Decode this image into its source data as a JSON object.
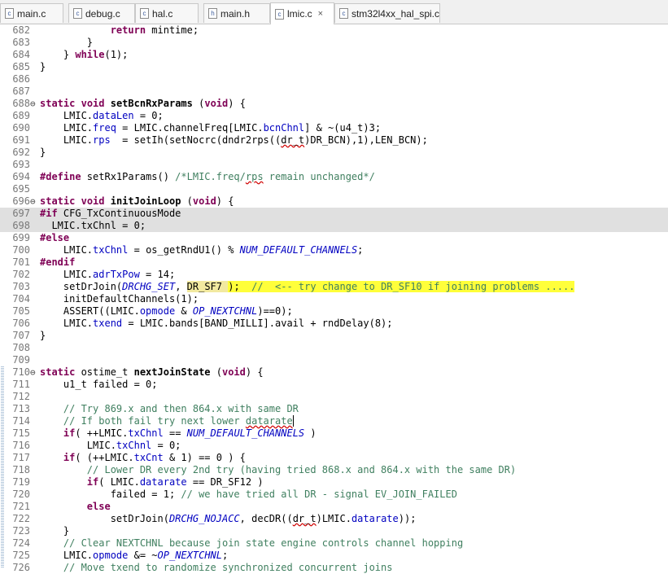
{
  "tabs": [
    {
      "label": "main.c",
      "icon": "c-file-icon",
      "active": false
    },
    {
      "label": "debug.c",
      "icon": "c-file-icon",
      "active": false
    },
    {
      "label": "hal.c",
      "icon": "c-file-icon",
      "active": false
    },
    {
      "label": "main.h",
      "icon": "h-file-icon",
      "active": false
    },
    {
      "label": "lmic.c",
      "icon": "c-file-icon",
      "active": true,
      "close": "×"
    },
    {
      "label": "stm32l4xx_hal_spi.c",
      "icon": "c-file-icon",
      "active": false
    }
  ],
  "colors": {
    "keyword": "#7f0055",
    "field": "#0000c0",
    "comment": "#3f7f5f",
    "highlight": "#ffff3a",
    "line_number": "#787878"
  },
  "lines": [
    {
      "n": "682",
      "seg": [
        {
          "t": "            "
        },
        {
          "t": "return",
          "c": "kw"
        },
        {
          "t": " mintime;"
        }
      ]
    },
    {
      "n": "683",
      "seg": [
        {
          "t": "        }"
        }
      ]
    },
    {
      "n": "684",
      "seg": [
        {
          "t": "    } "
        },
        {
          "t": "while",
          "c": "kw"
        },
        {
          "t": "(1);"
        }
      ]
    },
    {
      "n": "685",
      "seg": [
        {
          "t": "}"
        }
      ]
    },
    {
      "n": "686",
      "seg": []
    },
    {
      "n": "687",
      "seg": []
    },
    {
      "n": "688",
      "fold": "⊖",
      "seg": [
        {
          "t": "static",
          "c": "kw"
        },
        {
          "t": " "
        },
        {
          "t": "void",
          "c": "kw"
        },
        {
          "t": " "
        },
        {
          "t": "setBcnRxParams",
          "c": "b"
        },
        {
          "t": " ("
        },
        {
          "t": "void",
          "c": "kw"
        },
        {
          "t": ") {"
        }
      ]
    },
    {
      "n": "689",
      "seg": [
        {
          "t": "    LMIC."
        },
        {
          "t": "dataLen",
          "c": "fld"
        },
        {
          "t": " = 0;"
        }
      ]
    },
    {
      "n": "690",
      "seg": [
        {
          "t": "    LMIC."
        },
        {
          "t": "freq",
          "c": "fld"
        },
        {
          "t": " = LMIC.channelFreq[LMIC."
        },
        {
          "t": "bcnChnl",
          "c": "fld"
        },
        {
          "t": "] & ~(u4_t)3;"
        }
      ]
    },
    {
      "n": "691",
      "seg": [
        {
          "t": "    LMIC."
        },
        {
          "t": "rps",
          "c": "fld"
        },
        {
          "t": "  = setIh(setNocrc(dndr2rps(("
        },
        {
          "t": "dr_t",
          "c": "u"
        },
        {
          "t": ")DR_BCN),1),LEN_BCN);"
        }
      ]
    },
    {
      "n": "692",
      "seg": [
        {
          "t": "}"
        }
      ]
    },
    {
      "n": "693",
      "seg": []
    },
    {
      "n": "694",
      "seg": [
        {
          "t": "#define",
          "c": "kw"
        },
        {
          "t": " setRx1Params() "
        },
        {
          "t": "/*LMIC.freq/",
          "c": "cm"
        },
        {
          "t": "rps",
          "c": "cm u"
        },
        {
          "t": " remain unchanged*/",
          "c": "cm"
        }
      ]
    },
    {
      "n": "695",
      "seg": []
    },
    {
      "n": "696",
      "fold": "⊖",
      "seg": [
        {
          "t": "static",
          "c": "kw"
        },
        {
          "t": " "
        },
        {
          "t": "void",
          "c": "kw"
        },
        {
          "t": " "
        },
        {
          "t": "initJoinLoop",
          "c": "b"
        },
        {
          "t": " ("
        },
        {
          "t": "void",
          "c": "kw"
        },
        {
          "t": ") {"
        }
      ]
    },
    {
      "n": "697",
      "hl": true,
      "seg": [
        {
          "t": "#if",
          "c": "kw"
        },
        {
          "t": " CFG_TxContinuousMode"
        }
      ]
    },
    {
      "n": "698",
      "hl": true,
      "seg": [
        {
          "t": "  LMIC.txChnl = 0;"
        }
      ]
    },
    {
      "n": "699",
      "seg": [
        {
          "t": "#else",
          "c": "kw"
        }
      ]
    },
    {
      "n": "700",
      "seg": [
        {
          "t": "    LMIC."
        },
        {
          "t": "txChnl",
          "c": "fld"
        },
        {
          "t": " = os_getRndU1() % "
        },
        {
          "t": "NUM_DEFAULT_CHANNELS",
          "c": "it"
        },
        {
          "t": ";"
        }
      ]
    },
    {
      "n": "701",
      "seg": [
        {
          "t": "#endif",
          "c": "kw"
        }
      ]
    },
    {
      "n": "702",
      "seg": [
        {
          "t": "    LMIC."
        },
        {
          "t": "adrTxPow",
          "c": "fld"
        },
        {
          "t": " = 14;"
        }
      ]
    },
    {
      "n": "703",
      "seg": [
        {
          "t": "    setDrJoin("
        },
        {
          "t": "DRCHG_SET",
          "c": "it"
        },
        {
          "t": ", "
        },
        {
          "t": "DR_SF7 ",
          "c": "hi2"
        },
        {
          "t": ");",
          "c": "hi"
        },
        {
          "t": "  ",
          "c": "hi"
        },
        {
          "t": "//  <-- try change to DR_SF10 if joining problems .....",
          "c": "hi cm"
        }
      ]
    },
    {
      "n": "704",
      "seg": [
        {
          "t": "    initDefaultChannels(1);"
        }
      ]
    },
    {
      "n": "705",
      "seg": [
        {
          "t": "    ASSERT((LMIC."
        },
        {
          "t": "opmode",
          "c": "fld"
        },
        {
          "t": " & "
        },
        {
          "t": "OP_NEXTCHNL",
          "c": "it"
        },
        {
          "t": ")==0);"
        }
      ]
    },
    {
      "n": "706",
      "seg": [
        {
          "t": "    LMIC."
        },
        {
          "t": "txend",
          "c": "fld"
        },
        {
          "t": " = LMIC.bands[BAND_MILLI].avail + rndDelay(8);"
        }
      ]
    },
    {
      "n": "707",
      "seg": [
        {
          "t": "}"
        }
      ]
    },
    {
      "n": "708",
      "seg": []
    },
    {
      "n": "709",
      "seg": []
    },
    {
      "n": "710",
      "fold": "⊖",
      "seg": [
        {
          "t": "static",
          "c": "kw"
        },
        {
          "t": " ostime_t "
        },
        {
          "t": "nextJoinState",
          "c": "b"
        },
        {
          "t": " ("
        },
        {
          "t": "void",
          "c": "kw"
        },
        {
          "t": ") {"
        }
      ]
    },
    {
      "n": "711",
      "seg": [
        {
          "t": "    u1_t failed = 0;"
        }
      ]
    },
    {
      "n": "712",
      "seg": []
    },
    {
      "n": "713",
      "seg": [
        {
          "t": "    "
        },
        {
          "t": "// Try 869.x and then 864.x with same DR",
          "c": "cm"
        }
      ]
    },
    {
      "n": "714",
      "seg": [
        {
          "t": "    "
        },
        {
          "t": "// If both fail try next lower ",
          "c": "cm"
        },
        {
          "t": "datarate",
          "c": "cm u"
        }
      ],
      "caret": true
    },
    {
      "n": "715",
      "seg": [
        {
          "t": "    "
        },
        {
          "t": "if",
          "c": "kw"
        },
        {
          "t": "( ++LMIC."
        },
        {
          "t": "txChnl",
          "c": "fld"
        },
        {
          "t": " == "
        },
        {
          "t": "NUM_DEFAULT_CHANNELS",
          "c": "it"
        },
        {
          "t": " )"
        }
      ]
    },
    {
      "n": "716",
      "seg": [
        {
          "t": "        LMIC."
        },
        {
          "t": "txChnl",
          "c": "fld"
        },
        {
          "t": " = 0;"
        }
      ]
    },
    {
      "n": "717",
      "seg": [
        {
          "t": "    "
        },
        {
          "t": "if",
          "c": "kw"
        },
        {
          "t": "( (++LMIC."
        },
        {
          "t": "txCnt",
          "c": "fld"
        },
        {
          "t": " & 1) == 0 ) {"
        }
      ]
    },
    {
      "n": "718",
      "seg": [
        {
          "t": "        "
        },
        {
          "t": "// Lower DR every 2nd try (having tried 868.x and 864.x with the same DR)",
          "c": "cm"
        }
      ]
    },
    {
      "n": "719",
      "seg": [
        {
          "t": "        "
        },
        {
          "t": "if",
          "c": "kw"
        },
        {
          "t": "( LMIC."
        },
        {
          "t": "datarate",
          "c": "fld"
        },
        {
          "t": " == DR_SF12 )"
        }
      ]
    },
    {
      "n": "720",
      "seg": [
        {
          "t": "            failed = 1; "
        },
        {
          "t": "// we have tried all DR - signal EV_JOIN_FAILED",
          "c": "cm"
        }
      ]
    },
    {
      "n": "721",
      "seg": [
        {
          "t": "        "
        },
        {
          "t": "else",
          "c": "kw"
        }
      ]
    },
    {
      "n": "722",
      "seg": [
        {
          "t": "            setDrJoin("
        },
        {
          "t": "DRCHG_NOJACC",
          "c": "it"
        },
        {
          "t": ", decDR(("
        },
        {
          "t": "dr_t",
          "c": "u"
        },
        {
          "t": ")LMIC."
        },
        {
          "t": "datarate",
          "c": "fld"
        },
        {
          "t": "));"
        }
      ]
    },
    {
      "n": "723",
      "seg": [
        {
          "t": "    }"
        }
      ]
    },
    {
      "n": "724",
      "seg": [
        {
          "t": "    "
        },
        {
          "t": "// Clear NEXTCHNL because join state engine controls channel hopping",
          "c": "cm"
        }
      ]
    },
    {
      "n": "725",
      "seg": [
        {
          "t": "    LMIC."
        },
        {
          "t": "opmode",
          "c": "fld"
        },
        {
          "t": " &= ~"
        },
        {
          "t": "OP_NEXTCHNL",
          "c": "it"
        },
        {
          "t": ";"
        }
      ]
    },
    {
      "n": "726",
      "seg": [
        {
          "t": "    "
        },
        {
          "t": "// Move txend to randomize synchronized concurrent joins",
          "c": "cm"
        }
      ]
    }
  ]
}
